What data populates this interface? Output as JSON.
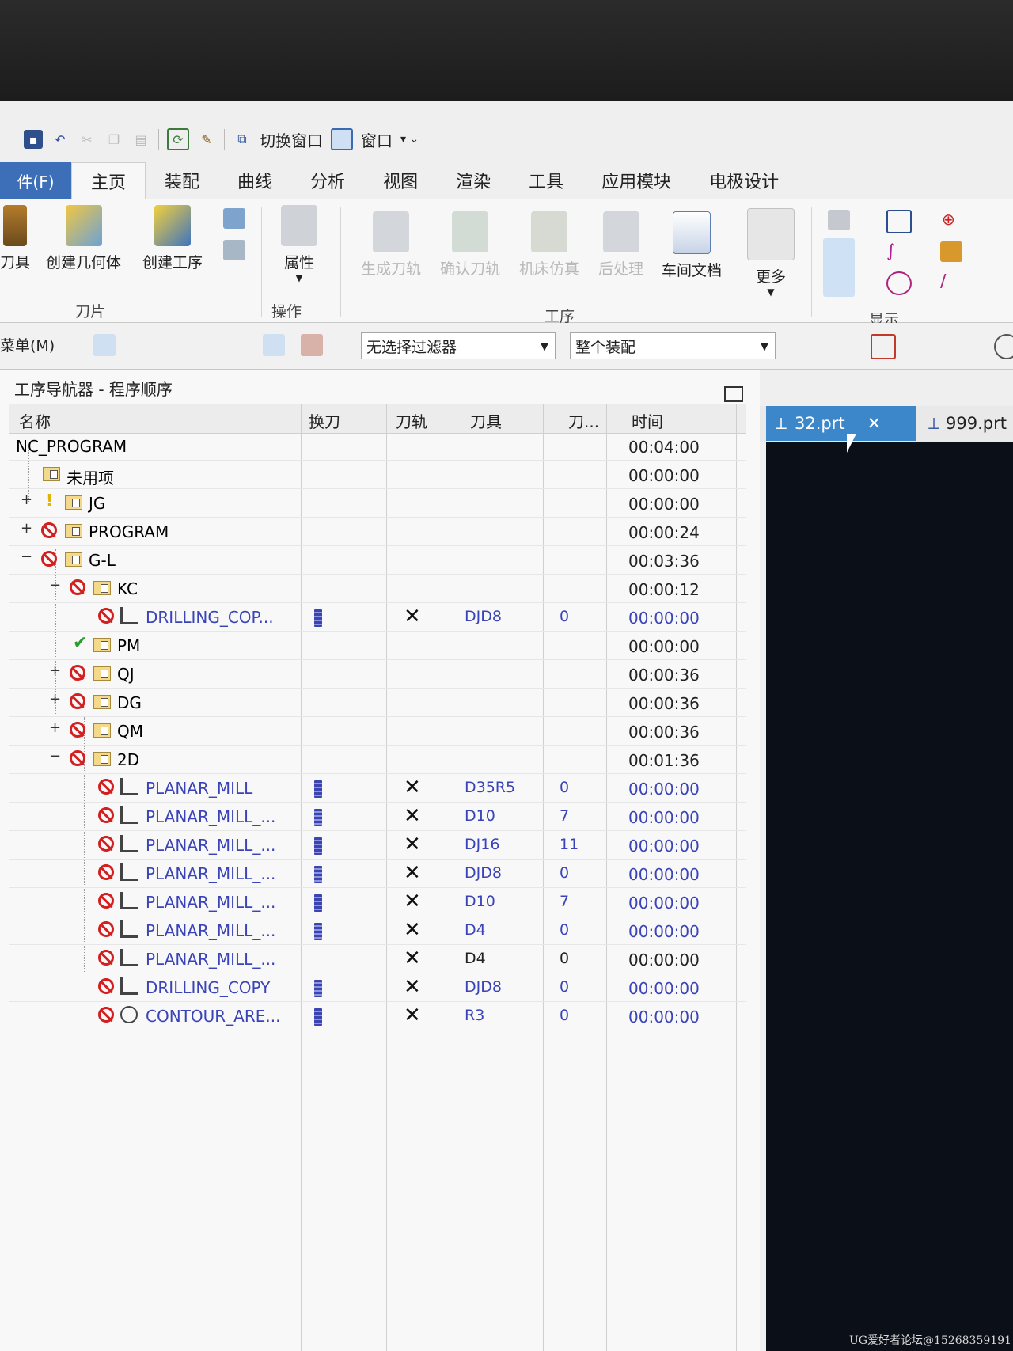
{
  "quick_access": {
    "switch_window": "切换窗口",
    "window": "窗口"
  },
  "tabs": {
    "file": "件(F)",
    "items": [
      "主页",
      "装配",
      "曲线",
      "分析",
      "视图",
      "渲染",
      "工具",
      "应用模块",
      "电极设计"
    ]
  },
  "ribbon": {
    "buttons": {
      "tool": "刀具",
      "create_geometry": "创建几何体",
      "create_operation": "创建工序",
      "properties": "属性",
      "generate_path": "生成刀轨",
      "verify_path": "确认刀轨",
      "machine_sim": "机床仿真",
      "postprocess": "后处理",
      "shop_doc": "车间文档",
      "more": "更多"
    },
    "groups": {
      "insert": "刀片",
      "operations": "操作",
      "process": "工序",
      "display": "显示"
    }
  },
  "selection_bar": {
    "menu": "菜单(M)",
    "filter": "无选择过滤器",
    "scope": "整个装配"
  },
  "navigator": {
    "title": "工序导航器 - 程序顺序",
    "columns": {
      "name": "名称",
      "toolchange": "换刀",
      "path": "刀轨",
      "tool": "刀具",
      "toolno": "刀...",
      "time": "时间"
    },
    "rows": [
      {
        "name": "NC_PROGRAM",
        "time": "00:04:00"
      },
      {
        "name": "未用项",
        "time": "00:00:00"
      },
      {
        "name": "JG",
        "time": "00:00:00"
      },
      {
        "name": "PROGRAM",
        "time": "00:00:24"
      },
      {
        "name": "G-L",
        "time": "00:03:36"
      },
      {
        "name": "KC",
        "time": "00:00:12"
      },
      {
        "name": "DRILLING_COP...",
        "tool": "DJD8",
        "num": "0",
        "time": "00:00:00"
      },
      {
        "name": "PM",
        "time": "00:00:00"
      },
      {
        "name": "QJ",
        "time": "00:00:36"
      },
      {
        "name": "DG",
        "time": "00:00:36"
      },
      {
        "name": "QM",
        "time": "00:00:36"
      },
      {
        "name": "2D",
        "time": "00:01:36"
      },
      {
        "name": "PLANAR_MILL",
        "tool": "D35R5",
        "num": "0",
        "time": "00:00:00"
      },
      {
        "name": "PLANAR_MILL_...",
        "tool": "D10",
        "num": "7",
        "time": "00:00:00"
      },
      {
        "name": "PLANAR_MILL_...",
        "tool": "DJ16",
        "num": "11",
        "time": "00:00:00"
      },
      {
        "name": "PLANAR_MILL_...",
        "tool": "DJD8",
        "num": "0",
        "time": "00:00:00"
      },
      {
        "name": "PLANAR_MILL_...",
        "tool": "D10",
        "num": "7",
        "time": "00:00:00"
      },
      {
        "name": "PLANAR_MILL_...",
        "tool": "D4",
        "num": "0",
        "time": "00:00:00"
      },
      {
        "name": "PLANAR_MILL_...",
        "tool": "D4",
        "num": "0",
        "time": "00:00:00"
      },
      {
        "name": "DRILLING_COPY",
        "tool": "DJD8",
        "num": "0",
        "time": "00:00:00"
      },
      {
        "name": "CONTOUR_ARE...",
        "tool": "R3",
        "num": "0",
        "time": "00:00:00"
      }
    ]
  },
  "doc_tabs": {
    "active": "32.prt",
    "other": "999.prt"
  },
  "watermark": "UG爱好者论坛@15268359191"
}
